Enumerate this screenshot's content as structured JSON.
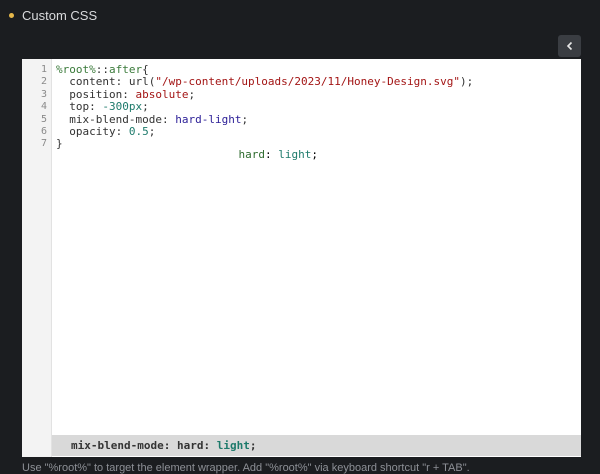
{
  "panel": {
    "title": "Custom CSS"
  },
  "icons": {
    "bullet": "dot-icon",
    "collapse": "chevron-left-icon"
  },
  "editor": {
    "line_numbers": [
      "1",
      "2",
      "3",
      "4",
      "5",
      "6",
      "7"
    ],
    "lines": [
      {
        "tokens": [
          {
            "t": "sel",
            "v": "%root%"
          },
          {
            "t": "prop",
            "v": "::"
          },
          {
            "t": "sel",
            "v": "after"
          },
          {
            "t": "prop",
            "v": "{"
          }
        ]
      },
      {
        "tokens": [
          {
            "t": "prop",
            "v": "  content: url("
          },
          {
            "t": "str",
            "v": "\"/wp-content/uploads/2023/11/Honey-Design.svg\""
          },
          {
            "t": "prop",
            "v": ");"
          }
        ]
      },
      {
        "tokens": [
          {
            "t": "prop",
            "v": "  position: "
          },
          {
            "t": "val",
            "v": "absolute"
          },
          {
            "t": "prop",
            "v": ";"
          }
        ]
      },
      {
        "tokens": [
          {
            "t": "prop",
            "v": "  top: "
          },
          {
            "t": "num",
            "v": "-300px"
          },
          {
            "t": "prop",
            "v": ";"
          }
        ]
      },
      {
        "tokens": [
          {
            "t": "prop",
            "v": "  mix-blend-mode: "
          },
          {
            "t": "kw",
            "v": "hard-light"
          },
          {
            "t": "prop",
            "v": ";"
          }
        ]
      },
      {
        "tokens": [
          {
            "t": "prop",
            "v": "  opacity: "
          },
          {
            "t": "num",
            "v": "0.5"
          },
          {
            "t": "prop",
            "v": ";"
          }
        ]
      },
      {
        "tokens": [
          {
            "t": "prop",
            "v": "}"
          }
        ]
      }
    ],
    "hint": {
      "prop": "hard",
      "sep": ": ",
      "val": "light",
      "end": ";"
    }
  },
  "status_bar": {
    "prop": "mix-blend-mode: hard",
    "sep": ": ",
    "val": "light",
    "end": ";"
  },
  "help_text": "Use \"%root%\" to target the element wrapper. Add \"%root%\" via keyboard shortcut \"r + TAB\"."
}
